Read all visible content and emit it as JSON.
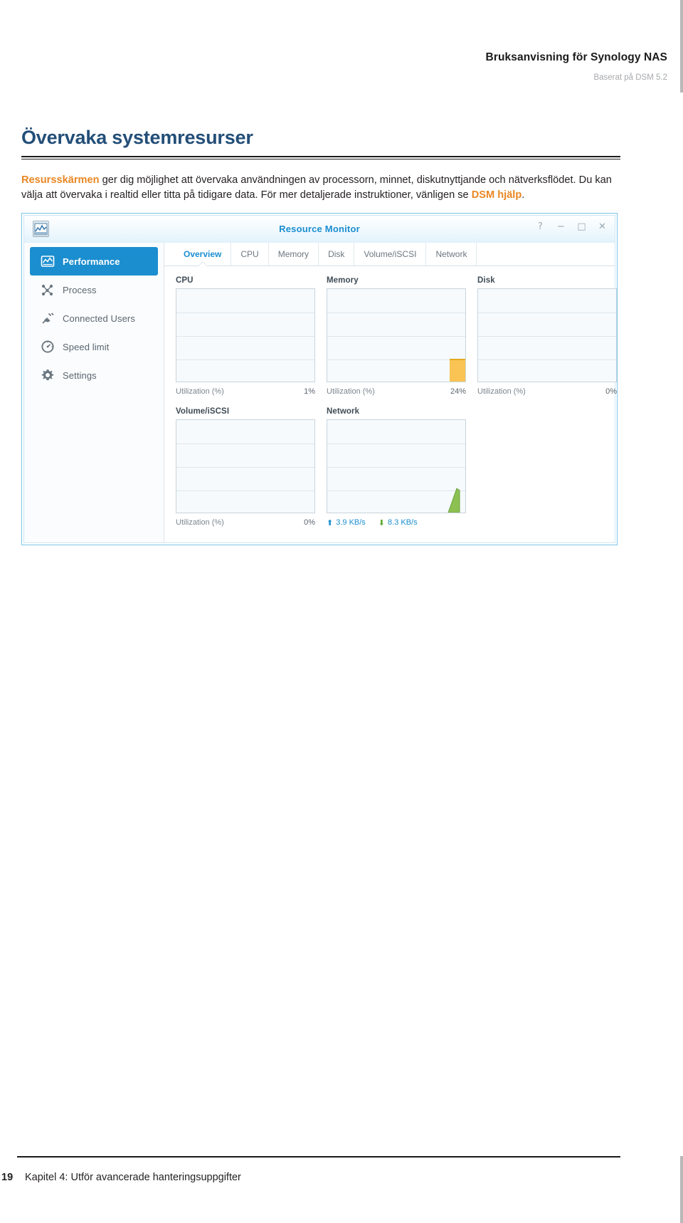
{
  "header": {
    "title": "Bruksanvisning för Synology NAS",
    "subtitle": "Baserat på DSM 5.2"
  },
  "section": {
    "title": "Övervaka systemresurser",
    "paragraph": {
      "highlight_1": "Resursskärmen",
      "text_1": " ger dig möjlighet att övervaka användningen av processorn, minnet, diskutnyttjande och nätverksflödet. Du kan välja att övervaka i realtid eller titta på tidigare data. För mer detaljerade instruktioner, vänligen se ",
      "highlight_2": "DSM hjälp",
      "text_2": "."
    }
  },
  "window": {
    "title": "Resource Monitor",
    "app_icon_name": "resource-monitor-icon",
    "controls": [
      {
        "name": "help-button",
        "glyph": "?"
      },
      {
        "name": "minimize-button",
        "glyph": "−"
      },
      {
        "name": "maximize-button",
        "glyph": "□"
      },
      {
        "name": "close-button",
        "glyph": "✕"
      }
    ],
    "sidebar": {
      "items": [
        {
          "label": "Performance",
          "icon": "performance-chart-icon",
          "active": true
        },
        {
          "label": "Process",
          "icon": "process-node-icon",
          "active": false
        },
        {
          "label": "Connected Users",
          "icon": "plug-icon",
          "active": false
        },
        {
          "label": "Speed limit",
          "icon": "speedometer-icon",
          "active": false
        },
        {
          "label": "Settings",
          "icon": "gear-icon",
          "active": false
        }
      ]
    },
    "tabs": [
      {
        "label": "Overview",
        "active": true
      },
      {
        "label": "CPU",
        "active": false
      },
      {
        "label": "Memory",
        "active": false
      },
      {
        "label": "Disk",
        "active": false
      },
      {
        "label": "Volume/iSCSI",
        "active": false
      },
      {
        "label": "Network",
        "active": false
      }
    ],
    "panels": {
      "cpu": {
        "caption": "CPU",
        "axis_label": "Utilization (%)",
        "value": "1%"
      },
      "memory": {
        "caption": "Memory",
        "axis_label": "Utilization (%)",
        "value": "24%"
      },
      "disk": {
        "caption": "Disk",
        "axis_label": "Utilization (%)",
        "value": "0%"
      },
      "volume": {
        "caption": "Volume/iSCSI",
        "axis_label": "Utilization (%)",
        "value": "0%"
      },
      "network": {
        "caption": "Network",
        "upload": "3.9 KB/s",
        "download": "8.3 KB/s",
        "upload_icon": "arrow-up-icon",
        "download_icon": "arrow-down-icon"
      }
    }
  },
  "chart_data": [
    {
      "type": "area",
      "title": "CPU",
      "ylabel": "Utilization (%)",
      "ylim": [
        0,
        100
      ],
      "grid": true,
      "gridlines": 4,
      "current_value": 1,
      "current_value_label": "1%",
      "values": [
        0,
        0,
        0,
        0,
        0,
        0,
        0,
        0,
        0,
        0,
        1
      ]
    },
    {
      "type": "area",
      "title": "Memory",
      "ylabel": "Utilization (%)",
      "ylim": [
        0,
        100
      ],
      "grid": true,
      "gridlines": 4,
      "current_value": 24,
      "current_value_label": "24%",
      "values": [
        0,
        0,
        0,
        0,
        0,
        0,
        0,
        0,
        0,
        24,
        24
      ]
    },
    {
      "type": "area",
      "title": "Disk",
      "ylabel": "Utilization (%)",
      "ylim": [
        0,
        100
      ],
      "grid": true,
      "gridlines": 4,
      "current_value": 0,
      "current_value_label": "0%",
      "values": [
        0,
        0,
        0,
        0,
        0,
        0,
        0,
        0,
        0,
        0,
        0
      ]
    },
    {
      "type": "area",
      "title": "Volume/iSCSI",
      "ylabel": "Utilization (%)",
      "ylim": [
        0,
        100
      ],
      "grid": true,
      "gridlines": 4,
      "current_value": 0,
      "current_value_label": "0%",
      "values": [
        0,
        0,
        0,
        0,
        0,
        0,
        0,
        0,
        0,
        0,
        0
      ]
    },
    {
      "type": "area",
      "title": "Network",
      "ylabel": "KB/s",
      "grid": true,
      "gridlines": 4,
      "series": [
        {
          "name": "Upload",
          "current_value_label": "3.9 KB/s"
        },
        {
          "name": "Download",
          "current_value_label": "8.3 KB/s"
        }
      ],
      "values": [
        0,
        0,
        0,
        0,
        0,
        0,
        0,
        0,
        0,
        0,
        30
      ]
    }
  ],
  "footer": {
    "page_number": "19",
    "text": "Kapitel 4: Utför avancerade hanteringsuppgifter"
  },
  "colors": {
    "title_blue": "#234e78",
    "accent_orange": "#e98724",
    "dsm_blue": "#1b8ed0",
    "memory_bar": "#f9c453",
    "network_green": "#8cc152"
  }
}
